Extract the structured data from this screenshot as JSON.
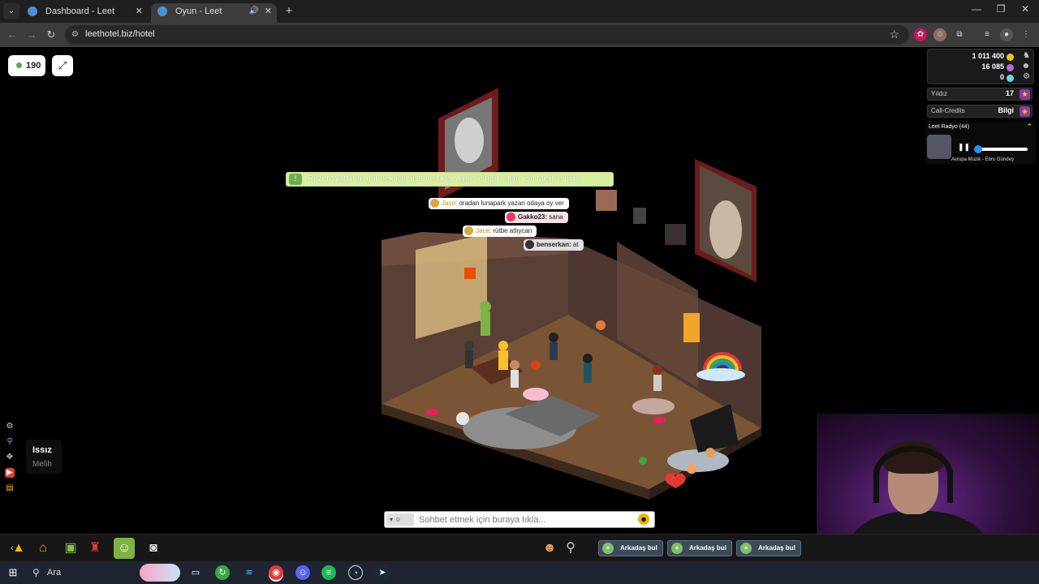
{
  "browser": {
    "tabs": [
      {
        "title": "Dashboard - Leet",
        "active": false
      },
      {
        "title": "Oyun - Leet",
        "active": true
      }
    ],
    "url": "leethotel.biz/hotel"
  },
  "hotel": {
    "online_count": "190",
    "purse": {
      "credits": "1 011 400",
      "duckets": "16 085",
      "diamonds": "0"
    },
    "stars": {
      "label": "Yıldız",
      "value": "17"
    },
    "call_credits": {
      "label": "Call-Credits",
      "value": "Bilgi"
    },
    "radio": {
      "title": "Leet Radyo (44)",
      "track": "Avrupa Muzik - Ebru Gündeş",
      "volume_fraction": 0.05
    },
    "notice": "Rozet fiyatlarını görmek için üstüne tıkla. Alım ve toplu alım için Melih'e ulaş.",
    "chat_bubbles": [
      {
        "user": "Jace",
        "text": ": oradan lunapark yazan odaya oy ver",
        "style": "yellow"
      },
      {
        "user": "Gakko23:",
        "text": " sana",
        "style": "red"
      },
      {
        "user": "Jace",
        "text": ": rütbe atlıycan",
        "style": "yellow"
      },
      {
        "user": "benserkan:",
        "text": " at",
        "style": "grey"
      }
    ],
    "room_info": {
      "name": "Issız",
      "owner": "Melih"
    },
    "chat_input": {
      "placeholder": "Sohbet etmek için buraya tıkla..."
    },
    "friend_bar": [
      "Arkadaş bul",
      "Arkadaş bul",
      "Arkadaş bul"
    ],
    "icons": {
      "side": [
        "gear-icon",
        "pin-icon",
        "controller-icon",
        "youtube-icon",
        "clipboard-icon"
      ],
      "bottom": [
        "catalog-icon",
        "navigator-icon",
        "inventory-icon",
        "shop-icon",
        "avatar-icon",
        "camera-icon"
      ]
    },
    "colors": {
      "notice_bg": "#d7f09d",
      "credits": "#f0c400",
      "duckets": "#b46bd8",
      "diamonds": "#6fd3e0"
    }
  },
  "taskbar": {
    "search_label": "Ara"
  }
}
